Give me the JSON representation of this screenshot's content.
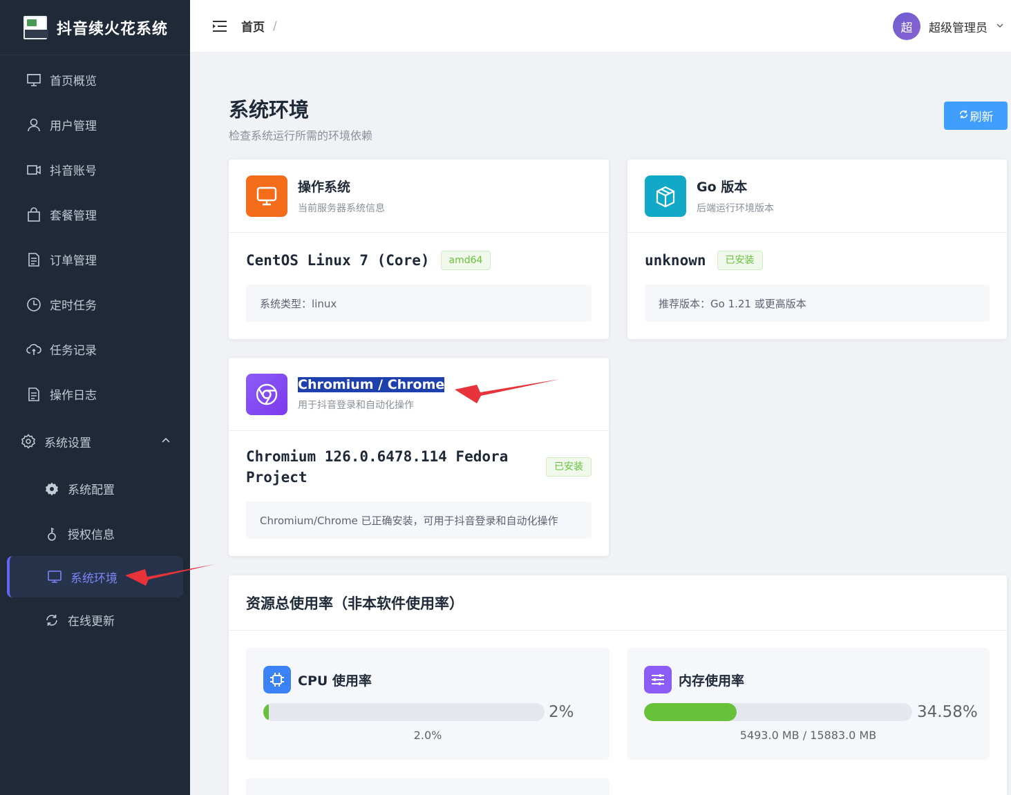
{
  "app": {
    "title": "抖音续火花系统"
  },
  "sidebar": {
    "items": [
      {
        "label": "首页概览",
        "icon": "presentation-icon"
      },
      {
        "label": "用户管理",
        "icon": "user-icon"
      },
      {
        "label": "抖音账号",
        "icon": "video-camera-icon"
      },
      {
        "label": "套餐管理",
        "icon": "shopping-bag-icon"
      },
      {
        "label": "订单管理",
        "icon": "document-icon"
      },
      {
        "label": "定时任务",
        "icon": "clock-icon"
      },
      {
        "label": "任务记录",
        "icon": "cloud-sync-icon"
      },
      {
        "label": "操作日志",
        "icon": "document-icon"
      }
    ],
    "group": {
      "label": "系统设置",
      "icon": "gear-icon"
    },
    "sub_items": [
      {
        "label": "系统配置",
        "icon": "gear-filled-icon"
      },
      {
        "label": "授权信息",
        "icon": "key-icon"
      },
      {
        "label": "系统环境",
        "icon": "monitor-icon",
        "active": true
      },
      {
        "label": "在线更新",
        "icon": "refresh-icon"
      }
    ]
  },
  "header": {
    "breadcrumb": "首页",
    "breadcrumb_sep": "/",
    "avatar_text": "超",
    "user_name": "超级管理员"
  },
  "page": {
    "title": "系统环境",
    "subtitle": "检查系统运行所需的环境依赖",
    "refresh_label": "刷新"
  },
  "cards": {
    "os": {
      "title": "操作系统",
      "desc": "当前服务器系统信息",
      "value": "CentOS Linux 7 (Core)",
      "tag": "amd64",
      "info": "系统类型：linux",
      "color": "#f36d1b"
    },
    "go": {
      "title": "Go 版本",
      "desc": "后端运行环境版本",
      "value": "unknown",
      "tag": "已安装",
      "info": "推荐版本：Go 1.21 或更高版本",
      "color": "#12a9c9"
    },
    "chrome": {
      "title": "Chromium / Chrome",
      "desc": "用于抖音登录和自动化操作",
      "value": "Chromium 126.0.6478.114 Fedora Project",
      "tag": "已安装",
      "info": "Chromium/Chrome 已正确安装，可用于抖音登录和自动化操作",
      "color": "#8b5cf6"
    }
  },
  "resources": {
    "title": "资源总使用率（非本软件使用率）",
    "cpu": {
      "label": "CPU 使用率",
      "percent": 2,
      "percent_text": "2%",
      "detail": "2.0%"
    },
    "memory": {
      "label": "内存使用率",
      "percent": 34.58,
      "percent_text": "34.58%",
      "detail": "5493.0 MB / 15883.0 MB"
    }
  },
  "colors": {
    "accent": "#409eff",
    "success": "#67c23a",
    "sidebar_bg": "#1f2937",
    "active": "#6366f1",
    "arrow": "#e8333a"
  }
}
